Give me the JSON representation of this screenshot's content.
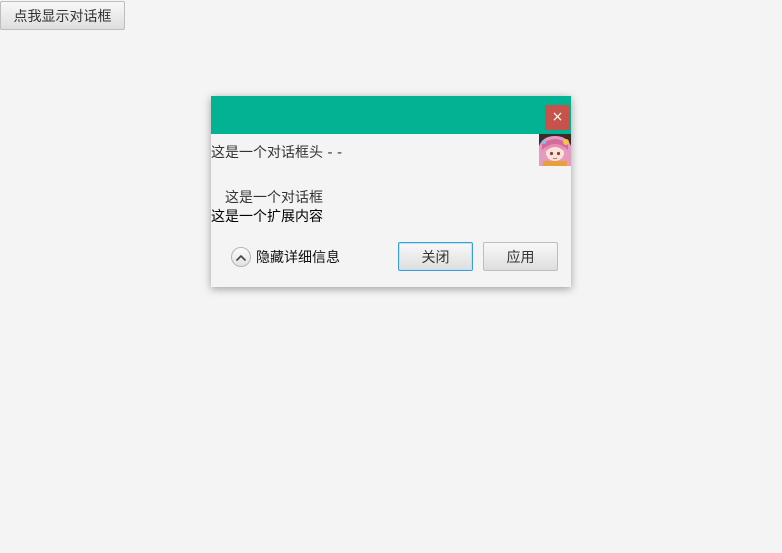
{
  "main": {
    "open_button_label": "点我显示对话框"
  },
  "dialog": {
    "close_glyph": "×",
    "header_text": "这是一个对话框头 - -",
    "content_text": "这是一个对话框",
    "extended_text": "这是一个扩展内容",
    "details_toggle_label": "隐藏详细信息",
    "details_toggle_icon": "chevron-up-icon",
    "buttons": {
      "close_label": "关闭",
      "apply_label": "应用"
    },
    "colors": {
      "titlebar": "#01b392",
      "close_x": "#c9514c",
      "default_button_border": "#3a9ed8"
    }
  }
}
